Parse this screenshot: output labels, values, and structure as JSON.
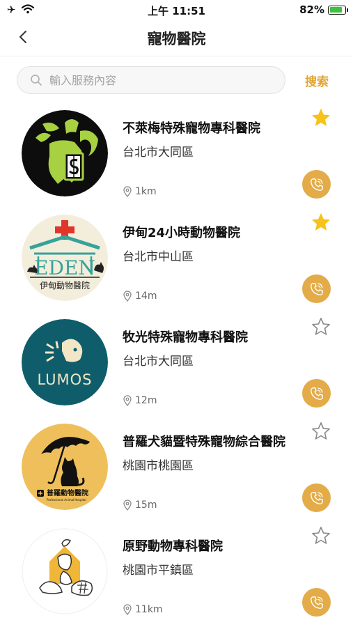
{
  "status_bar": {
    "left_icons": "✈ ",
    "time": "上午 11:51",
    "battery_percent": "82%",
    "battery_level": 0.82
  },
  "nav": {
    "back_icon": "chevron-left-icon",
    "title": "寵物醫院"
  },
  "search": {
    "placeholder": "輸入服務內容",
    "value": "",
    "button_label": "搜索"
  },
  "colors": {
    "accent": "#e3ac49",
    "star_filled": "#f6c21c",
    "star_empty": "#888888"
  },
  "hospitals": [
    {
      "name": "不萊梅特殊寵物專科醫院",
      "district": "台北市大同區",
      "distance": "1km",
      "favorite": true
    },
    {
      "name": "伊甸24小時動物醫院",
      "district": "台北市中山區",
      "distance": "14m",
      "favorite": true
    },
    {
      "name": "牧光特殊寵物專科醫院",
      "district": "台北市大同區",
      "distance": "12m",
      "favorite": false
    },
    {
      "name": "普羅犬貓暨特殊寵物綜合醫院",
      "district": "桃園市桃園區",
      "distance": "15m",
      "favorite": false
    },
    {
      "name": "原野動物專科醫院",
      "district": "桃園市平鎮區",
      "distance": "11km",
      "favorite": false
    }
  ],
  "logos": {
    "eden": {
      "wordmark": "EDEN",
      "caption": "伊甸動物醫院"
    },
    "lumos": {
      "wordmark": "LUMOS"
    },
    "pro": {
      "caption": "普羅動物醫院",
      "subcaption": "Professional Animal Hospital"
    }
  }
}
